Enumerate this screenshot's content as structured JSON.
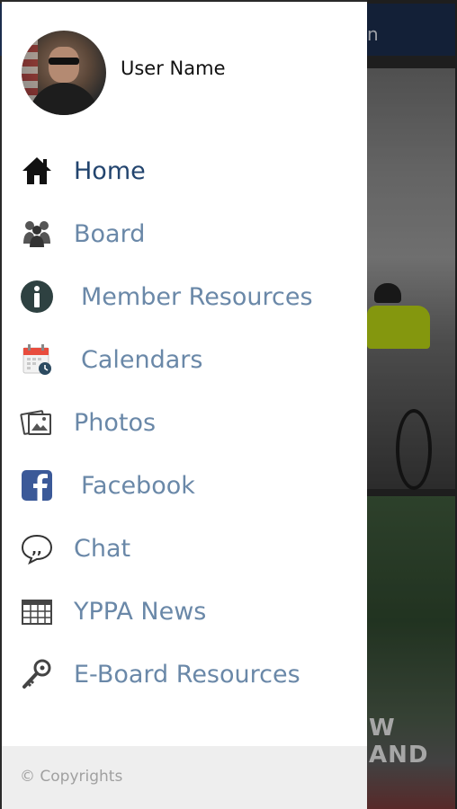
{
  "background": {
    "header_text": "n",
    "photo_text": "W AND"
  },
  "drawer": {
    "user_name": "User Name",
    "menu": [
      {
        "label": "Home",
        "icon": "home-icon",
        "active": true
      },
      {
        "label": "Board",
        "icon": "group-icon",
        "active": false
      },
      {
        "label": "Member Resources",
        "icon": "info-icon",
        "active": false
      },
      {
        "label": "Calendars",
        "icon": "calendar-icon",
        "active": false
      },
      {
        "label": "Photos",
        "icon": "photos-icon",
        "active": false
      },
      {
        "label": "Facebook",
        "icon": "facebook-icon",
        "active": false
      },
      {
        "label": "Chat",
        "icon": "chat-icon",
        "active": false
      },
      {
        "label": "YPPA News",
        "icon": "news-icon",
        "active": false
      },
      {
        "label": "E-Board Resources",
        "icon": "key-icon",
        "active": false
      }
    ],
    "footer": "© Copyrights"
  },
  "colors": {
    "active_label": "#22446e",
    "inactive_label": "#6a88a8",
    "header_bg": "#1b2d4d",
    "footer_bg": "#eeeeee"
  }
}
